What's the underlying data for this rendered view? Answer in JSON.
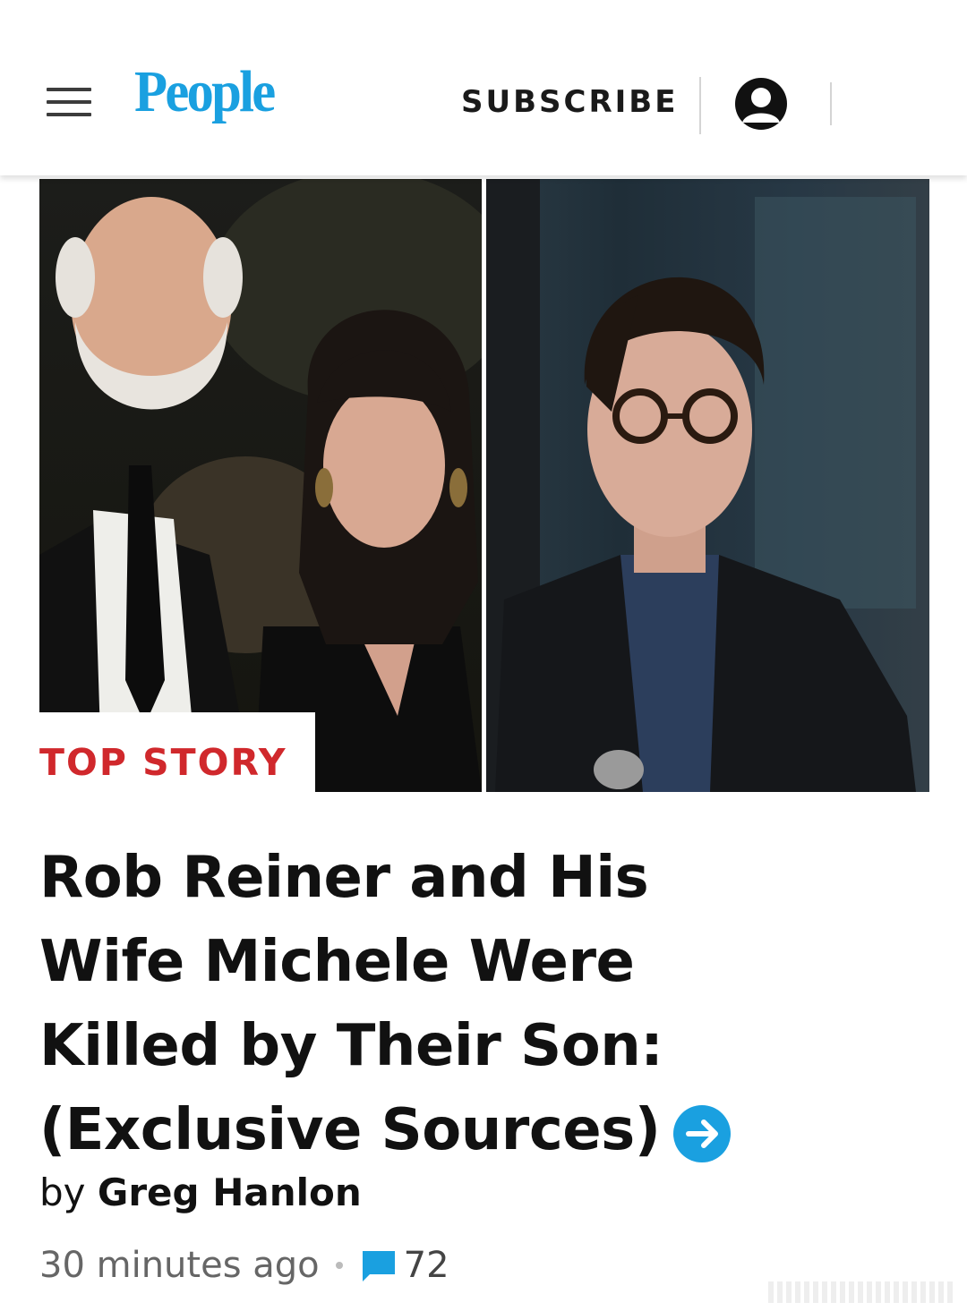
{
  "header": {
    "logo": "People",
    "subscribe_label": "SUBSCRIBE"
  },
  "article": {
    "label": "TOP STORY",
    "headline_lines": [
      "Rob Reiner and His",
      "Wife Michele Were",
      "Killed by Their Son:",
      "(Exclusive Sources)"
    ],
    "byline_prefix": "by",
    "author": "Greg Hanlon",
    "time_ago": "30 minutes ago",
    "comment_count": "72"
  },
  "colors": {
    "brand": "#1aa0e0",
    "label": "#d0282c",
    "text": "#111111",
    "meta": "#666666"
  },
  "icons": {
    "menu": "menu-icon",
    "account": "account-icon",
    "arrow": "arrow-right-icon",
    "comment": "comment-icon"
  }
}
